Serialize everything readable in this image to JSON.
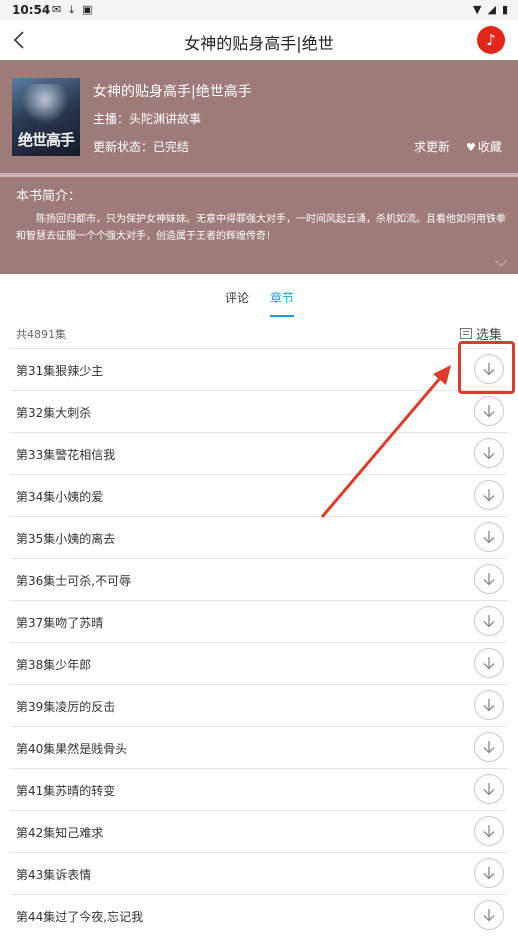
{
  "status_bar": {
    "time": "10:54"
  },
  "header": {
    "title": "女神的贴身高手|绝世"
  },
  "book": {
    "cover_text": "绝世高手",
    "title": "女神的贴身高手|绝世高手",
    "host_label": "主播：头陀渊讲故事",
    "status_label": "更新状态：已完结",
    "request_update": "求更新",
    "collect": "收藏"
  },
  "intro": {
    "heading": "本书简介：",
    "text": "陈扬回归都市，只为保护女神妹妹。无意中得罪强大对手，一时间风起云涌，杀机如流。且看他如何用铁拳和智慧去征服一个个强大对手，创造属于王者的辉煌传奇！"
  },
  "tabs": {
    "comments": "评论",
    "chapters": "章节"
  },
  "list_header": {
    "count": "共4891集",
    "select": "选集"
  },
  "chapters": [
    "第31集狠辣少主",
    "第32集大刺杀",
    "第33集警花相信我",
    "第34集小姨的爱",
    "第35集小姨的离去",
    "第36集士可杀,不可辱",
    "第37集吻了苏晴",
    "第38集少年郎",
    "第39集凌厉的反击",
    "第40集果然是贱骨头",
    "第41集苏晴的转变",
    "第42集知己难求",
    "第43集诉表情",
    "第44集过了今夜,忘记我"
  ],
  "colors": {
    "accent": "#1aa0d8",
    "book_bg": "#9c7b79",
    "annotation": "#e03a2a",
    "music_button": "#e1261c"
  }
}
